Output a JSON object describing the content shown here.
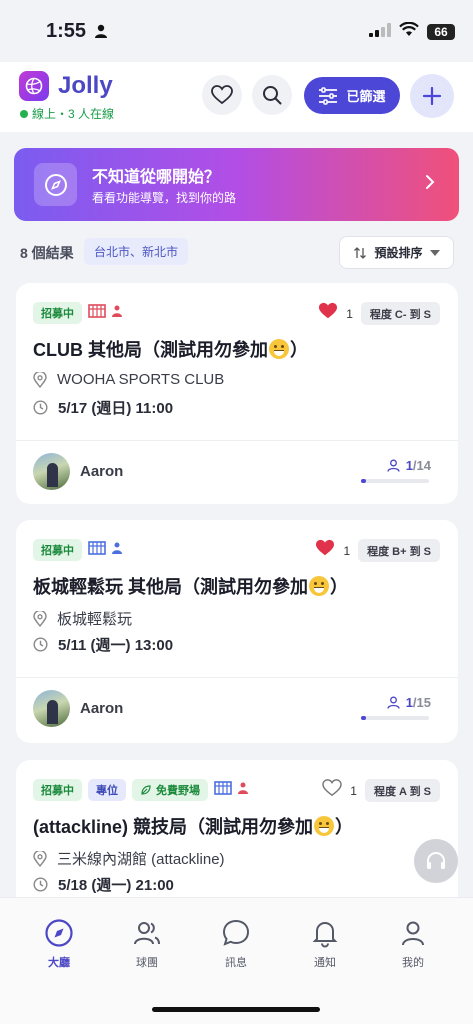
{
  "status_bar": {
    "time": "1:55",
    "battery": "66"
  },
  "header": {
    "brand": "Jolly",
    "online_text": "線上・3 人在線",
    "filter_label": "已篩選"
  },
  "banner": {
    "title": "不知道從哪開始？",
    "subtitle": "看看功能導覽，找到你的路"
  },
  "results": {
    "count_text": "8 個結果",
    "region": "台北市、新北市",
    "sort_label": "預設排序"
  },
  "cards": [
    {
      "tags": [
        "招募中"
      ],
      "likes": "1",
      "liked": true,
      "level": "程度 C- 到 S",
      "title_pre": "CLUB 其他局（測試用勿參加",
      "title_post": "）",
      "location": "WOOHA SPORTS CLUB",
      "time": "5/17 (週日)  11:00",
      "host": "Aaron",
      "joined": "1",
      "capacity": "/14",
      "fill_fraction": 0.07,
      "court_color": "#e04b5c"
    },
    {
      "tags": [
        "招募中"
      ],
      "likes": "1",
      "liked": true,
      "level": "程度 B+ 到 S",
      "title_pre": "板城輕鬆玩 其他局（測試用勿參加",
      "title_post": "）",
      "location": "板城輕鬆玩",
      "time": "5/11 (週一)  13:00",
      "host": "Aaron",
      "joined": "1",
      "capacity": "/15",
      "fill_fraction": 0.07,
      "court_color": "#4c6fe0"
    },
    {
      "tags": [
        "招募中",
        "專位",
        "免費野場"
      ],
      "likes": "1",
      "liked": false,
      "level": "程度 A 到 S",
      "title_pre": "(attackline) 競技局（測試用勿參加",
      "title_post": "）",
      "location": "三米線內湖館 (attackline)",
      "time": "5/18 (週一)  21:00",
      "court_color": "#4c6fe0"
    }
  ],
  "nav": [
    {
      "label": "大廳",
      "icon": "compass-icon",
      "active": true
    },
    {
      "label": "球團",
      "icon": "people-icon",
      "active": false
    },
    {
      "label": "訊息",
      "icon": "chat-icon",
      "active": false
    },
    {
      "label": "通知",
      "icon": "bell-icon",
      "active": false
    },
    {
      "label": "我的",
      "icon": "user-icon",
      "active": false
    }
  ],
  "colors": {
    "accent": "#4c47d6",
    "heart": "#e0324b",
    "green": "#1b8a3c"
  }
}
